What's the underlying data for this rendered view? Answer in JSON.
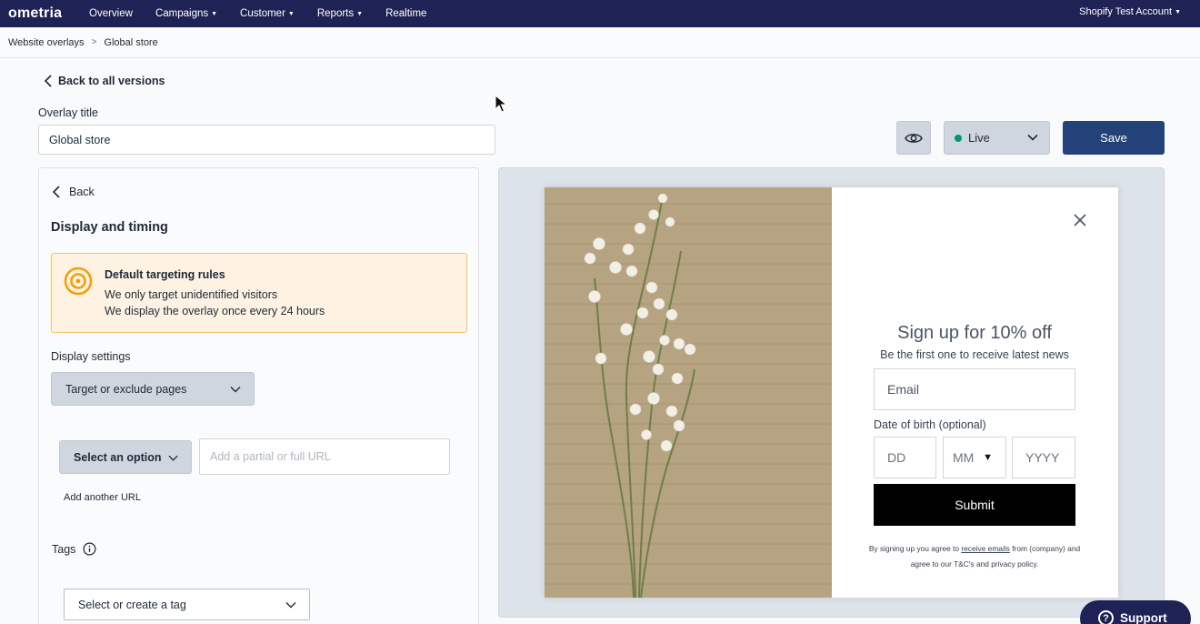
{
  "brand": {
    "logo": "ometria",
    "nav_bg": "#1e2254"
  },
  "nav": {
    "items": [
      {
        "label": "Overview",
        "caret": false
      },
      {
        "label": "Campaigns",
        "caret": true
      },
      {
        "label": "Customer",
        "caret": true
      },
      {
        "label": "Reports",
        "caret": true
      },
      {
        "label": "Realtime",
        "caret": false
      }
    ],
    "account": "Shopify Test Account"
  },
  "breadcrumb": {
    "items": [
      "Website overlays",
      "Global store"
    ],
    "separator": ">"
  },
  "editor": {
    "back_link": "Back to all versions",
    "title_label": "Overlay title",
    "title_value": "Global store",
    "status": "Live",
    "status_color": "#059669",
    "save_label": "Save"
  },
  "panel": {
    "back_label": "Back",
    "heading": "Display and timing",
    "notice": {
      "title": "Default targeting rules",
      "line1": "We only target unidentified visitors",
      "line2": "We display the overlay once every 24 hours",
      "icon": "target-icon"
    },
    "display_settings_label": "Display settings",
    "target_dropdown": "Target or exclude pages",
    "rule_select": "Select an option",
    "url_placeholder": "Add a partial or full URL",
    "add_url": "Add another URL",
    "tags_label": "Tags",
    "tag_select": "Select or create a tag"
  },
  "preview": {
    "title": "Sign up for 10% off",
    "subtitle": "Be the first one to receive latest news",
    "email_placeholder": "Email",
    "dob_label": "Date of birth (optional)",
    "dob_day": "DD",
    "dob_month": "MM",
    "dob_year": "YYYY",
    "submit": "Submit",
    "legal_1": "By signing up you agree to ",
    "legal_link": "receive emails",
    "legal_2": " from (company) and agree to our T&C's and privacy policy."
  },
  "support": {
    "label": "Support"
  }
}
